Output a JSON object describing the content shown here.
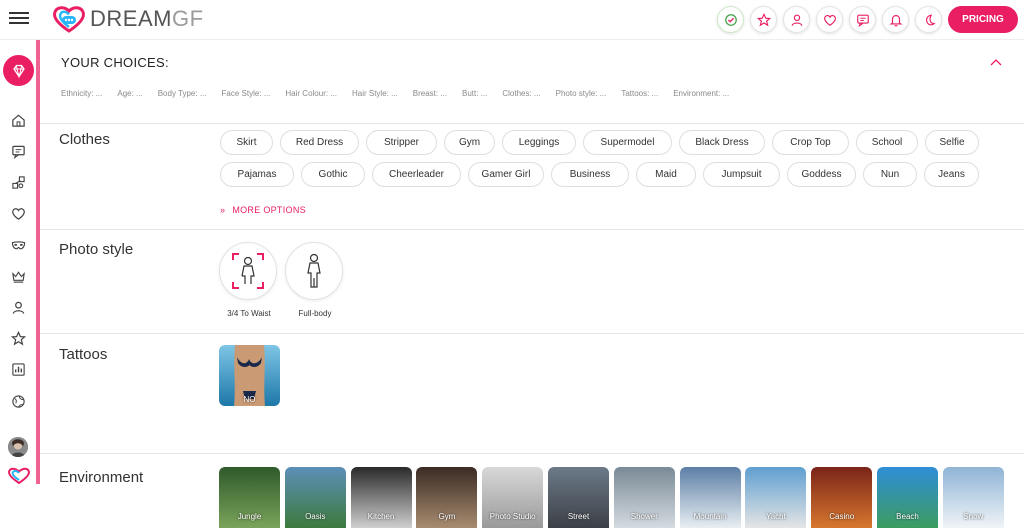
{
  "app": {
    "logo_bold": "DREAM",
    "logo_light": "GF"
  },
  "header": {
    "pricing_label": "PRICING",
    "icons": [
      "verified-badge-icon",
      "star-icon",
      "user-icon",
      "heart-icon",
      "chat-icon",
      "bell-icon",
      "moon-icon"
    ]
  },
  "sidebar": {
    "icons": [
      "diamond-icon",
      "home-icon",
      "chat-icon",
      "share-icon",
      "heart-icon",
      "mask-icon",
      "crown-icon",
      "user-icon",
      "star-icon",
      "chart-icon",
      "globe-icon"
    ]
  },
  "choices": {
    "title": "YOUR CHOICES:",
    "items": [
      "Ethnicity: ...",
      "Age: ...",
      "Body Type: ...",
      "Face Style: ...",
      "Hair Colour: ...",
      "Hair Style: ...",
      "Breast: ...",
      "Butt: ...",
      "Clothes: ...",
      "Photo style: ...",
      "Tattoos: ...",
      "Environment: ..."
    ]
  },
  "clothes": {
    "title": "Clothes",
    "row1": [
      "Skirt",
      "Red Dress",
      "Stripper",
      "Gym",
      "Leggings",
      "Supermodel",
      "Black Dress",
      "Crop Top",
      "School",
      "Selfie"
    ],
    "row2": [
      "Pajamas",
      "Gothic",
      "Cheerleader",
      "Gamer Girl",
      "Business",
      "Maid",
      "Jumpsuit",
      "Goddess",
      "Nun",
      "Jeans"
    ],
    "more_options": "MORE OPTIONS"
  },
  "photo_style": {
    "title": "Photo style",
    "options": [
      "3/4 To Waist",
      "Full-body"
    ]
  },
  "tattoos": {
    "title": "Tattoos",
    "options": [
      "NO"
    ]
  },
  "environment": {
    "title": "Environment",
    "options": [
      "Jungle",
      "Oasis",
      "Kitchen",
      "Gym",
      "Photo Studio",
      "Street",
      "Shower",
      "Mountain",
      "Yacht",
      "Casino",
      "Beach",
      "Snow"
    ]
  },
  "colors": {
    "accent": "#e91e63",
    "rail": "#f06292"
  }
}
